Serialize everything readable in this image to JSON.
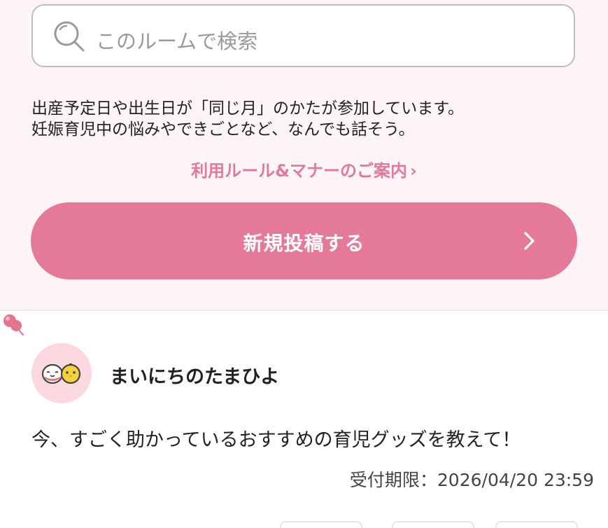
{
  "search": {
    "placeholder": "このルームで検索"
  },
  "intro": {
    "line1": "出産予定日や出生日が「同じ月」のかたが参加しています。",
    "line2": "妊娠育児中の悩みやできごとなど、なんでも話そう。"
  },
  "rules_link": {
    "label": "利用ルール&マナーのご案内",
    "chevron": "›"
  },
  "new_post_button": {
    "label": "新規投稿する"
  },
  "post": {
    "author": "まいにちのたまひよ",
    "text": "今、すごく助かっているおすすめの育児グッズを教えて！",
    "deadline_label": "受付期限：",
    "deadline_value": "2026/04/20 23:59"
  },
  "icons": {
    "search": "search-icon",
    "pin": "pin-icon",
    "chevron": "chevron-right-icon",
    "avatar": "egg-chick-avatar"
  },
  "colors": {
    "accent": "#e57a98",
    "link": "#e07a98",
    "panel_background": "#fdf4f7",
    "avatar_background": "#fbd9de"
  }
}
